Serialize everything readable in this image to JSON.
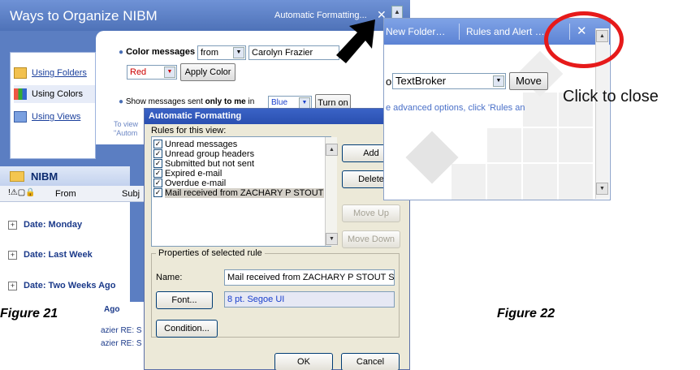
{
  "figure21": {
    "title": "Ways to Organize NIBM",
    "autofmt_link": "Automatic Formatting...",
    "nav": [
      {
        "label": "Using Folders"
      },
      {
        "label": "Using Colors"
      },
      {
        "label": "Using Views"
      }
    ],
    "color_messages": {
      "label": "Color messages",
      "from_select": "from",
      "from_value": "Carolyn Frazier",
      "color_select": "Red",
      "apply_button": "Apply Color"
    },
    "show_messages": {
      "prefix": "Show messages sent",
      "bold": "only to me",
      "suffix": "in",
      "color_select": "Blue",
      "turn_on_button": "Turn on"
    },
    "hint_text": [
      "To view",
      "\"Autom"
    ],
    "folder": {
      "name": "NIBM",
      "col_from": "From",
      "col_subject": "Subj",
      "groups": [
        "Date: Monday",
        "Date: Last Week",
        "Date: Two Weeks Ago"
      ],
      "fragments": [
        "Ago",
        "azier  RE: S",
        "azier  RE: S"
      ]
    },
    "dialog": {
      "title": "Automatic Formatting",
      "rules_label": "Rules for this view:",
      "rules": [
        {
          "label": "Unread messages",
          "checked": true
        },
        {
          "label": "Unread group headers",
          "checked": true
        },
        {
          "label": "Submitted but not sent",
          "checked": true
        },
        {
          "label": "Expired e-mail",
          "checked": true
        },
        {
          "label": "Overdue e-mail",
          "checked": true
        },
        {
          "label": "Mail received from ZACHARY P STOUT ST(",
          "checked": true
        }
      ],
      "add_button": "Add",
      "delete_button": "Delete",
      "move_up_button": "Move Up",
      "move_down_button": "Move Down",
      "props_label": "Properties of selected rule",
      "name_label": "Name:",
      "name_value": "Mail received from ZACHARY P STOUT STOUT",
      "font_button": "Font...",
      "font_value": "8 pt. Segoe UI",
      "condition_button": "Condition...",
      "ok_button": "OK",
      "cancel_button": "Cancel"
    },
    "caption": "Figure 21"
  },
  "figure22": {
    "tabs": [
      "New Folder…",
      "Rules and Alert …"
    ],
    "close_symbol": "✕",
    "to_prefix": "o",
    "folder_select": "TextBroker",
    "move_button": "Move",
    "advanced_text": "e advanced options, click 'Rules an",
    "click_caption": "Click to close",
    "caption": "Figure 22"
  },
  "colors": {
    "outlook_blue": "#5b7ec2",
    "dialog_bg": "#ece9d8",
    "ring_red": "#e61a1a",
    "red_text": "#cc0000",
    "blue_text": "#1a3fcc"
  }
}
